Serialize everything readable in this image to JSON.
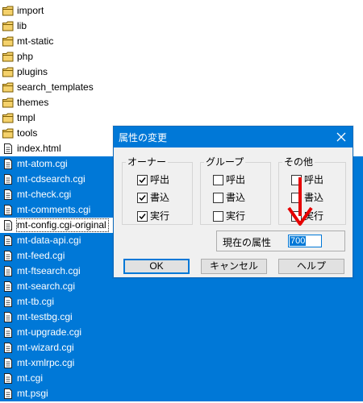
{
  "files": [
    {
      "name": "import",
      "type": "folder",
      "selected": false
    },
    {
      "name": "lib",
      "type": "folder",
      "selected": false
    },
    {
      "name": "mt-static",
      "type": "folder",
      "selected": false
    },
    {
      "name": "php",
      "type": "folder",
      "selected": false
    },
    {
      "name": "plugins",
      "type": "folder",
      "selected": false
    },
    {
      "name": "search_templates",
      "type": "folder",
      "selected": false
    },
    {
      "name": "themes",
      "type": "folder",
      "selected": false
    },
    {
      "name": "tmpl",
      "type": "folder",
      "selected": false
    },
    {
      "name": "tools",
      "type": "folder",
      "selected": false
    },
    {
      "name": "index.html",
      "type": "file",
      "selected": false
    },
    {
      "name": "mt-atom.cgi",
      "type": "file",
      "selected": true
    },
    {
      "name": "mt-cdsearch.cgi",
      "type": "file",
      "selected": true
    },
    {
      "name": "mt-check.cgi",
      "type": "file",
      "selected": true
    },
    {
      "name": "mt-comments.cgi",
      "type": "file",
      "selected": true
    },
    {
      "name": "mt-config.cgi-original",
      "type": "file",
      "selected": false,
      "focused": true
    },
    {
      "name": "mt-data-api.cgi",
      "type": "file",
      "selected": true
    },
    {
      "name": "mt-feed.cgi",
      "type": "file",
      "selected": true
    },
    {
      "name": "mt-ftsearch.cgi",
      "type": "file",
      "selected": true
    },
    {
      "name": "mt-search.cgi",
      "type": "file",
      "selected": true
    },
    {
      "name": "mt-tb.cgi",
      "type": "file",
      "selected": true
    },
    {
      "name": "mt-testbg.cgi",
      "type": "file",
      "selected": true
    },
    {
      "name": "mt-upgrade.cgi",
      "type": "file",
      "selected": true
    },
    {
      "name": "mt-wizard.cgi",
      "type": "file",
      "selected": true
    },
    {
      "name": "mt-xmlrpc.cgi",
      "type": "file",
      "selected": true
    },
    {
      "name": "mt.cgi",
      "type": "file",
      "selected": true
    },
    {
      "name": "mt.psgi",
      "type": "file",
      "selected": true
    }
  ],
  "dialog": {
    "title": "属性の変更",
    "groups": [
      {
        "label": "オーナー",
        "items": [
          {
            "label": "呼出",
            "checked": true
          },
          {
            "label": "書込",
            "checked": true
          },
          {
            "label": "実行",
            "checked": true
          }
        ]
      },
      {
        "label": "グループ",
        "items": [
          {
            "label": "呼出",
            "checked": false
          },
          {
            "label": "書込",
            "checked": false
          },
          {
            "label": "実行",
            "checked": false
          }
        ]
      },
      {
        "label": "その他",
        "items": [
          {
            "label": "呼出",
            "checked": false
          },
          {
            "label": "書込",
            "checked": false
          },
          {
            "label": "実行",
            "checked": false
          }
        ]
      }
    ],
    "current_attr_label": "現在の属性",
    "current_attr_value": "700",
    "buttons": {
      "ok": "OK",
      "cancel": "キャンセル",
      "help": "ヘルプ"
    }
  },
  "colors": {
    "selection": "#0078d7",
    "annotation_arrow": "#e60000"
  }
}
